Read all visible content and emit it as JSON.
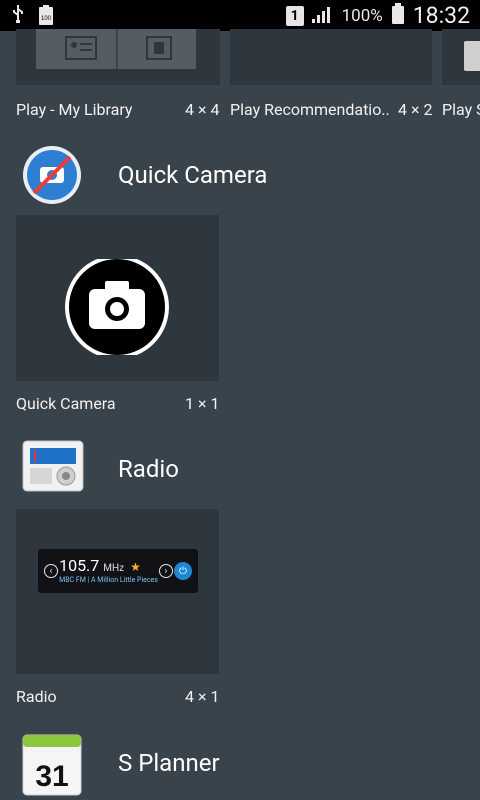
{
  "status_bar": {
    "sim_slot": "1",
    "battery_percent": "100%",
    "time": "18:32",
    "battery_badge": "100"
  },
  "widgets_top": [
    {
      "label": "Play - My Library",
      "size": "4 × 4"
    },
    {
      "label": "Play Recommendatio..",
      "size": "4 × 2"
    },
    {
      "label": "Play S",
      "size": ""
    }
  ],
  "sections": [
    {
      "app_title": "Quick Camera",
      "widget_label": "Quick Camera",
      "widget_size": "1 × 1"
    },
    {
      "app_title": "Radio",
      "widget_label": "Radio",
      "widget_size": "4 × 1",
      "radio_widget": {
        "frequency": "105.7",
        "unit": "MHz",
        "subtitle": "MBC FM  |  A Million Little Pieces"
      }
    },
    {
      "app_title": "S Planner",
      "icon_day": "31"
    }
  ]
}
